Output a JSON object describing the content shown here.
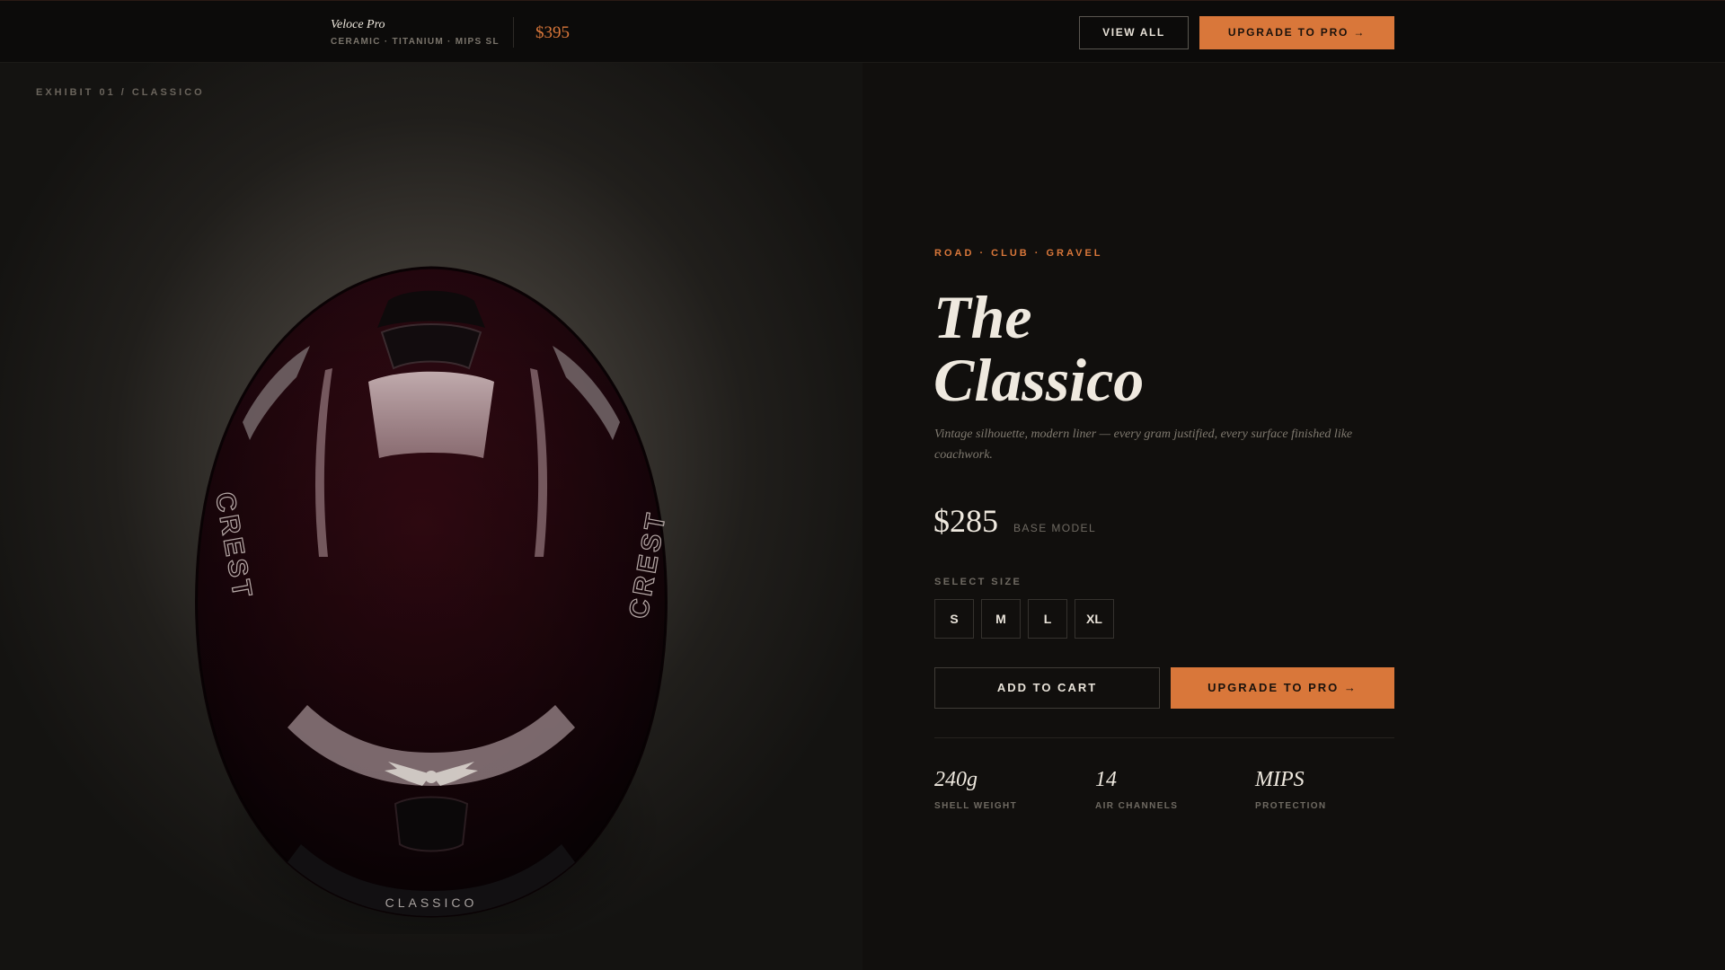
{
  "topbar": {
    "product_name": "Veloce Pro",
    "product_sub": "CERAMIC · TITANIUM · MIPS SL",
    "price": "$395",
    "view_all_label": "VIEW ALL",
    "upgrade_label": "UPGRADE TO PRO →"
  },
  "hero": {
    "exhibit_label": "EXHIBIT 01 / CLASSICO",
    "helmet_brand_left": "CREST",
    "helmet_brand_right": "CREST",
    "helmet_model": "CLASSICO"
  },
  "product": {
    "eyebrow": "ROAD · CLUB · GRAVEL",
    "title_line1": "The",
    "title_line2": "Classico",
    "description": "Vintage silhouette, modern liner — every gram justified, every surface finished like coachwork.",
    "price": "$285",
    "price_note": "BASE MODEL",
    "size_label": "SELECT SIZE",
    "sizes": [
      "S",
      "M",
      "L",
      "XL"
    ],
    "add_to_cart_label": "ADD TO CART",
    "upgrade_label": "UPGRADE TO PRO →",
    "specs": [
      {
        "value": "240g",
        "label": "SHELL WEIGHT"
      },
      {
        "value": "14",
        "label": "AIR CHANNELS"
      },
      {
        "value": "MIPS",
        "label": "PROTECTION"
      }
    ]
  },
  "colors": {
    "accent": "#d9773a",
    "background": "#110f0d",
    "helmet_shell": "#4a0f1c"
  }
}
